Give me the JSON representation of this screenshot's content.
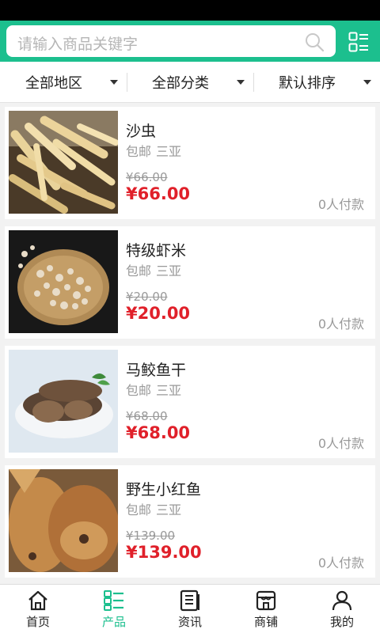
{
  "search": {
    "placeholder": "请输入商品关键字"
  },
  "filters": [
    {
      "label": "全部地区"
    },
    {
      "label": "全部分类"
    },
    {
      "label": "默认排序"
    }
  ],
  "products": [
    {
      "name": "沙虫",
      "tags": [
        "包邮",
        "三亚"
      ],
      "old_price": "¥66.00",
      "price": "¥66.00",
      "paid": "0人付款"
    },
    {
      "name": "特级虾米",
      "tags": [
        "包邮",
        "三亚"
      ],
      "old_price": "¥20.00",
      "price": "¥20.00",
      "paid": "0人付款"
    },
    {
      "name": "马鲛鱼干",
      "tags": [
        "包邮",
        "三亚"
      ],
      "old_price": "¥68.00",
      "price": "¥68.00",
      "paid": "0人付款"
    },
    {
      "name": "野生小红鱼",
      "tags": [
        "包邮",
        "三亚"
      ],
      "old_price": "¥139.00",
      "price": "¥139.00",
      "paid": "0人付款"
    }
  ],
  "tabs": [
    {
      "label": "首页",
      "icon": "home-icon"
    },
    {
      "label": "产品",
      "icon": "grid-list-icon",
      "active": true
    },
    {
      "label": "资讯",
      "icon": "news-icon"
    },
    {
      "label": "商铺",
      "icon": "shop-icon"
    },
    {
      "label": "我的",
      "icon": "user-icon"
    }
  ],
  "colors": {
    "accent": "#1cbf8e",
    "price": "#e0202a"
  }
}
